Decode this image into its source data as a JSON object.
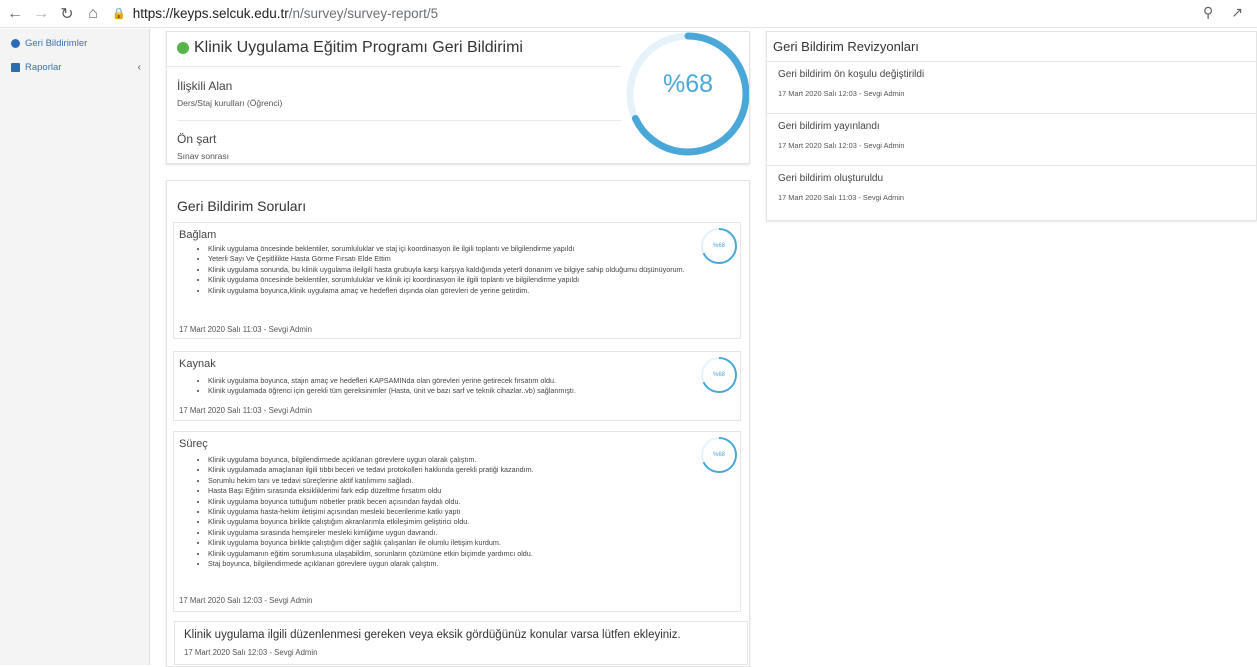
{
  "browser": {
    "url_host": "https://keyps.selcuk.edu.tr",
    "url_path": "/n/survey/survey-report/5"
  },
  "sidebar": {
    "items": [
      {
        "label": "Geri Bildirimler"
      },
      {
        "label": "Raporlar"
      }
    ]
  },
  "summary": {
    "title": "Klinik Uygulama Eğitim Programı Geri Bildirimi",
    "percent": "%68",
    "percent_value": 0.68,
    "related_label": "İlişkili Alan",
    "related_value": "Ders/Staj kurulları (Öğrenci)",
    "precondition_label": "Ön şart",
    "precondition_value": "Sınav sonrası"
  },
  "questions": {
    "header": "Geri Bildirim Soruları",
    "sections": [
      {
        "title": "Bağlam",
        "percent": "%68",
        "items": [
          "Klinik uygulama öncesinde beklentiler, sorumluluklar ve staj içi koordinasyon ile ilgili toplantı ve bilgilendirme yapıldı",
          "Yeterli Sayı Ve Çeşitlilikte Hasta Görme Fırsatı Elde Ettim",
          "Klinik uygulama sonunda, bu klinik uygulama ileilgili hasta grubuyla karşı karşıya kaldığımda yeterli donanım ve bilgiye sahip olduğumu düşünüyorum.",
          "Klinik uygulama öncesinde beklentiler, sorumluluklar ve klinik içi koordinasyon ile ilgili toplantı ve bilgilendirme yapıldı",
          "Klinik uygulama boyunca,klinik uygulama amaç ve hedefleri dışında olan görevleri de yerine getirdim."
        ],
        "date": "17 Mart 2020 Salı 11:03 - Sevgi Admin"
      },
      {
        "title": "Kaynak",
        "percent": "%68",
        "items": [
          "Klinik uygulama boyunca, stajın amaç ve hedefleri KAPSAMINda olan görevleri yerine getirecek fırsatım oldu.",
          "Klinik uygulamada öğrenci için gerekli tüm gereksinimler (Hasta, ünit ve bazı sarf ve teknik cihazlar..vb) sağlanmıştı."
        ],
        "date": "17 Mart 2020 Salı 11:03 - Sevgi Admin"
      },
      {
        "title": "Süreç",
        "percent": "%68",
        "items": [
          "Klinik uygulama boyunca, bilgilendirmede açıklanan görevlere uygun olarak çalıştım.",
          "Klinik uygulamada amaçlanan ilgili tıbbi beceri ve tedavi protokolleri hakkında gerekli pratiği kazandım.",
          "Sorumlu hekim tanı ve tedavi süreçlerine aktif katılımımı sağladı.",
          "Hasta Başı Eğitim sırasında eksikliklerimi fark edip düzeltme fırsatım oldu",
          "Klinik uygulama boyunca tuttuğum nöbetler pratik beceri açısından faydalı oldu.",
          "Klinik uygulama hasta-hekim iletişimi açısından mesleki becerilerime katkı yaptı",
          "Klinik uygulama boyunca birlikte çalıştığım akranlarımla etkileşimim geliştirici oldu.",
          "Klinik uygulama sırasında hemşireler mesleki kimliğime uygun davrandı.",
          "Klinik uygulama boyunca birlikte çalıştığım diğer sağlık çalışanları ile olumlu iletişim kurdum.",
          "Klinik uygulamanın eğitim sorumlusuna ulaşabildim, sorunların çözümüne etkin biçimde yardımcı oldu.",
          "Staj boyunca, bilgilendirmede açıklanan görevlere uygun olarak çalıştım."
        ],
        "date": "17 Mart 2020 Salı 12:03 - Sevgi Admin"
      }
    ],
    "open_question": {
      "text": "Klinik uygulama ilgili düzenlenmesi gereken veya eksik gördüğünüz konular varsa lütfen ekleyiniz.",
      "date": "17 Mart 2020 Salı 12:03 - Sevgi Admin"
    }
  },
  "revisions": {
    "title": "Geri Bildirim Revizyonları",
    "items": [
      {
        "text": "Geri bildirim ön koşulu değiştirildi",
        "date": "17 Mart 2020 Salı 12:03 - Sevgi Admin"
      },
      {
        "text": "Geri bildirim yayınlandı",
        "date": "17 Mart 2020 Salı 12:03 - Sevgi Admin"
      },
      {
        "text": "Geri bildirim oluşturuldu",
        "date": "17 Mart 2020 Salı 11:03 - Sevgi Admin"
      }
    ]
  },
  "colors": {
    "accent": "#4aa8d8",
    "status_green": "#55b549",
    "sidebar_link": "#3a6fb0"
  }
}
